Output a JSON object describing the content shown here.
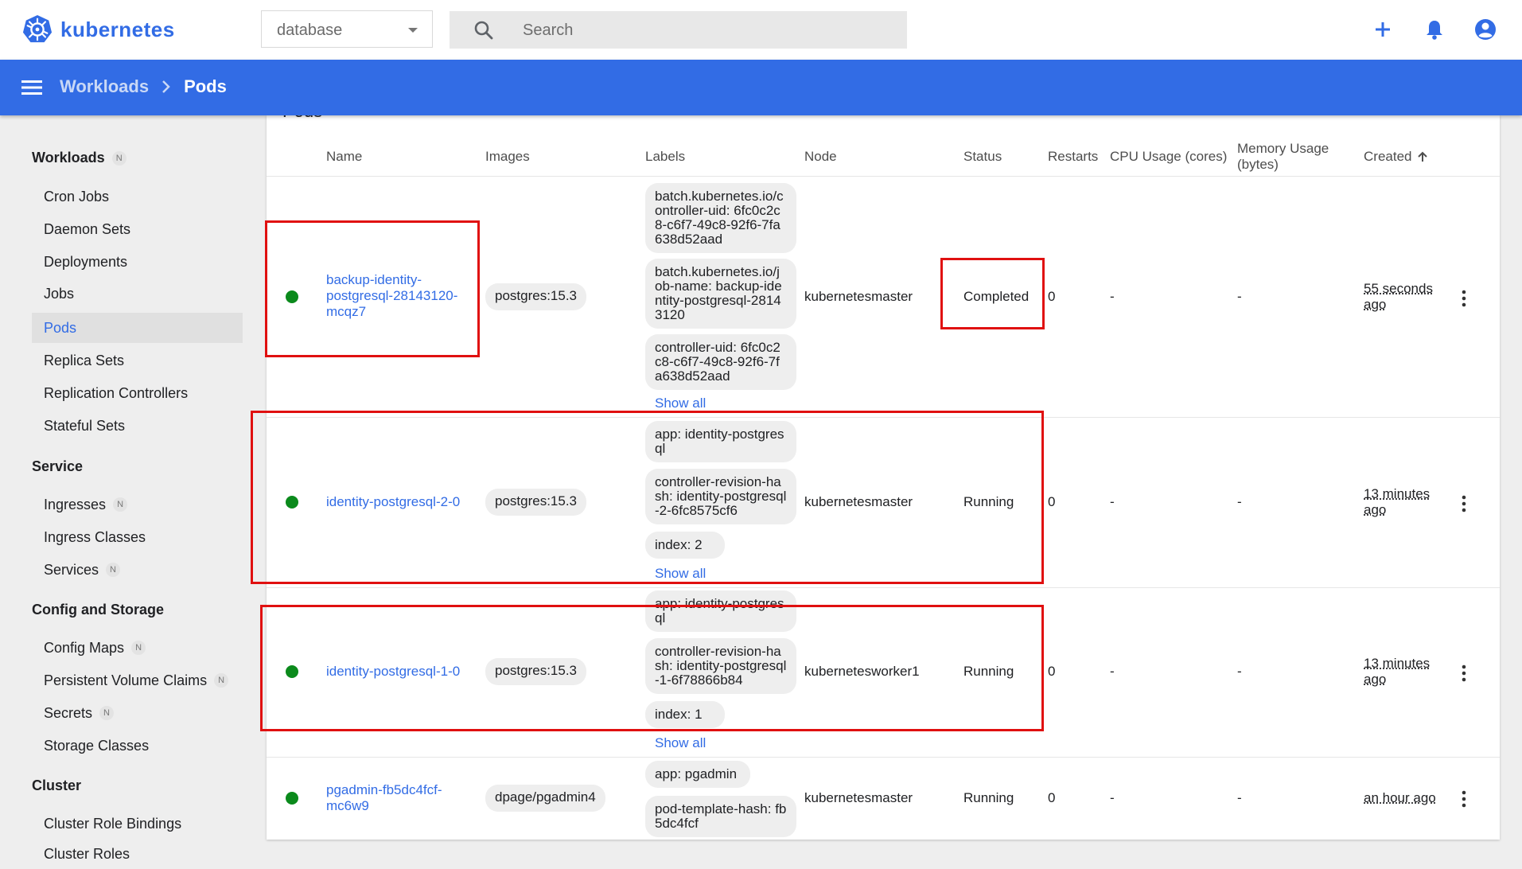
{
  "app": {
    "name": "kubernetes"
  },
  "namespace": {
    "selected": "database"
  },
  "search": {
    "placeholder": "Search"
  },
  "breadcrumb": {
    "parent": "Workloads",
    "current": "Pods"
  },
  "card_title": "Pods",
  "sidebar": {
    "sections": [
      {
        "title": "Workloads",
        "badge": "N",
        "items": [
          {
            "label": "Cron Jobs"
          },
          {
            "label": "Daemon Sets"
          },
          {
            "label": "Deployments"
          },
          {
            "label": "Jobs"
          },
          {
            "label": "Pods"
          },
          {
            "label": "Replica Sets"
          },
          {
            "label": "Replication Controllers"
          },
          {
            "label": "Stateful Sets"
          }
        ]
      },
      {
        "title": "Service",
        "items": [
          {
            "label": "Ingresses",
            "badge": "N"
          },
          {
            "label": "Ingress Classes"
          },
          {
            "label": "Services",
            "badge": "N"
          }
        ]
      },
      {
        "title": "Config and Storage",
        "items": [
          {
            "label": "Config Maps",
            "badge": "N"
          },
          {
            "label": "Persistent Volume Claims",
            "badge": "N"
          },
          {
            "label": "Secrets",
            "badge": "N"
          },
          {
            "label": "Storage Classes"
          }
        ]
      },
      {
        "title": "Cluster",
        "items": [
          {
            "label": "Cluster Role Bindings"
          },
          {
            "label": "Cluster Roles"
          }
        ]
      }
    ]
  },
  "table": {
    "headers": {
      "name": "Name",
      "images": "Images",
      "labels": "Labels",
      "node": "Node",
      "status": "Status",
      "restarts": "Restarts",
      "cpu": "CPU Usage (cores)",
      "memory": "Memory Usage (bytes)",
      "created": "Created"
    },
    "show_all": "Show all",
    "rows": [
      {
        "name": "backup-identity-postgresql-28143120-mcqz7",
        "image": "postgres:15.3",
        "labels": [
          "batch.kubernetes.io/controller-uid: 6fc0c2c8-c6f7-49c8-92f6-7fa638d52aad",
          "batch.kubernetes.io/job-name: backup-identity-postgresql-28143120",
          "controller-uid: 6fc0c2c8-c6f7-49c8-92f6-7fa638d52aad"
        ],
        "node": "kubernetesmaster",
        "status": "Completed",
        "restarts": "0",
        "cpu": "-",
        "memory": "-",
        "created": "55 seconds ago"
      },
      {
        "name": "identity-postgresql-2-0",
        "image": "postgres:15.3",
        "labels": [
          "app: identity-postgresql",
          "controller-revision-hash: identity-postgresql-2-6fc8575cf6",
          "index: 2"
        ],
        "node": "kubernetesmaster",
        "status": "Running",
        "restarts": "0",
        "cpu": "-",
        "memory": "-",
        "created": "13 minutes ago"
      },
      {
        "name": "identity-postgresql-1-0",
        "image": "postgres:15.3",
        "labels": [
          "app: identity-postgresql",
          "controller-revision-hash: identity-postgresql-1-6f78866b84",
          "index: 1"
        ],
        "node": "kubernetesworker1",
        "status": "Running",
        "restarts": "0",
        "cpu": "-",
        "memory": "-",
        "created": "13 minutes ago"
      },
      {
        "name": "pgadmin-fb5dc4fcf-mc6w9",
        "image": "dpage/pgadmin4",
        "labels": [
          "app: pgadmin",
          "pod-template-hash: fb5dc4fcf"
        ],
        "node": "kubernetesmaster",
        "status": "Running",
        "restarts": "0",
        "cpu": "-",
        "memory": "-",
        "created": "an hour ago"
      }
    ]
  },
  "colors": {
    "brand": "#326ce5",
    "running_dot": "#0b8a1c",
    "highlight": "#e01010"
  }
}
